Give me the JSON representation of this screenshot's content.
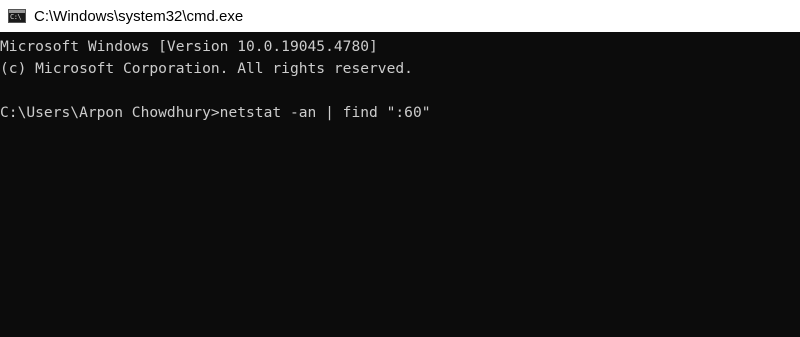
{
  "window": {
    "title": "C:\\Windows\\system32\\cmd.exe",
    "icon": "cmd-console-icon",
    "icon_glyph": "C:\\",
    "colors": {
      "titlebar_bg": "#ffffff",
      "console_bg": "#0c0c0c",
      "console_text": "#cccccc"
    }
  },
  "console": {
    "lines": [
      "Microsoft Windows [Version 10.0.19045.4780]",
      "(c) Microsoft Corporation. All rights reserved.",
      "",
      "C:\\Users\\Arpon Chowdhury>netstat -an | find \":60\""
    ]
  }
}
